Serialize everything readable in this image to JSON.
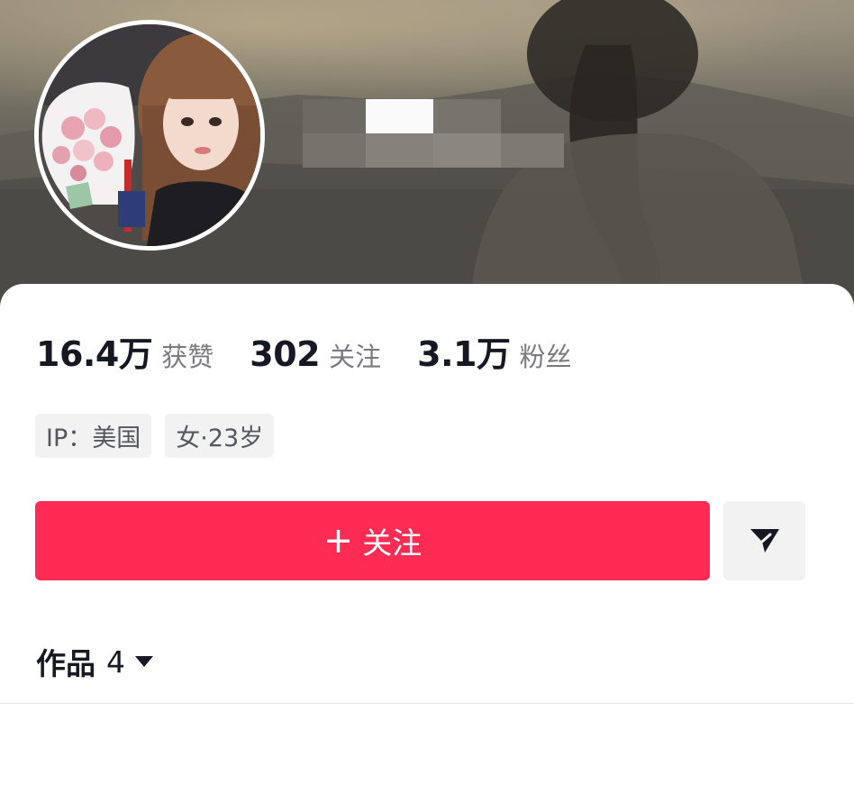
{
  "profile": {
    "stats": [
      {
        "number": "16.4万",
        "label": "获赞"
      },
      {
        "number": "302",
        "label": "关注"
      },
      {
        "number": "3.1万",
        "label": "粉丝"
      }
    ],
    "tags": {
      "ip": "IP：美国",
      "gender_age": "女·23岁"
    }
  },
  "actions": {
    "follow_plus": "+",
    "follow_label": "关注",
    "share_icon": "paper-plane-icon"
  },
  "works": {
    "label": "作品",
    "count": "4",
    "caret_icon": "caret-down-icon"
  },
  "colors": {
    "accent": "#fe2c55",
    "text_primary": "#161823",
    "text_secondary": "#7a7b80",
    "tag_bg": "#f2f2f3"
  }
}
